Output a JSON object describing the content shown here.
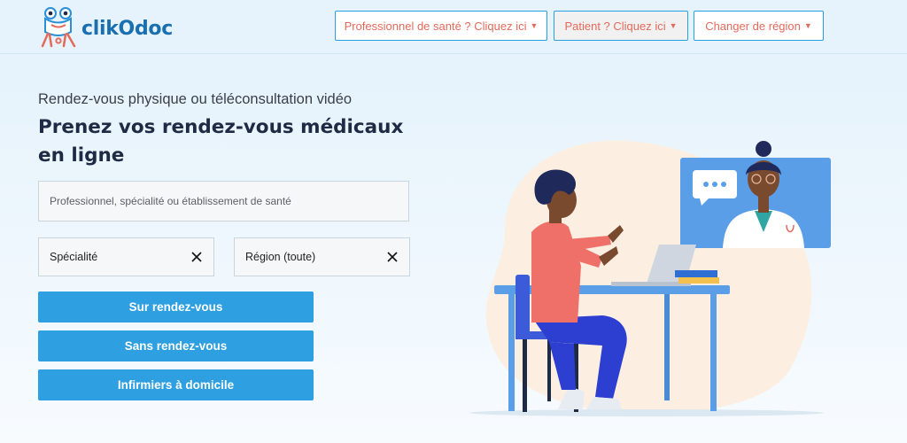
{
  "header": {
    "logo_text": "clikOdoc",
    "nav": [
      {
        "label": "Professionnel de santé ? Cliquez ici"
      },
      {
        "label": "Patient ? Cliquez ici"
      },
      {
        "label": "Changer de région"
      }
    ]
  },
  "main": {
    "subtitle": "Rendez-vous physique ou téléconsultation vidéo",
    "headline": "Prenez vos rendez-vous médicaux en ligne",
    "search": {
      "placeholder": "Professionnel, spécialité ou établissement de santé",
      "value": ""
    },
    "specialty": {
      "label": "Spécialité"
    },
    "region": {
      "label": "Région (toute)"
    },
    "buttons": [
      {
        "label": "Sur rendez-vous"
      },
      {
        "label": "Sans rendez-vous"
      },
      {
        "label": "Infirmiers à domicile"
      }
    ]
  },
  "colors": {
    "primary": "#2e9fe0",
    "accent": "#e46a5a",
    "brand": "#1a6fb0",
    "headline": "#1f2a44"
  },
  "icons": [
    "frog-logo-icon",
    "chevron-down-icon",
    "close-icon"
  ]
}
